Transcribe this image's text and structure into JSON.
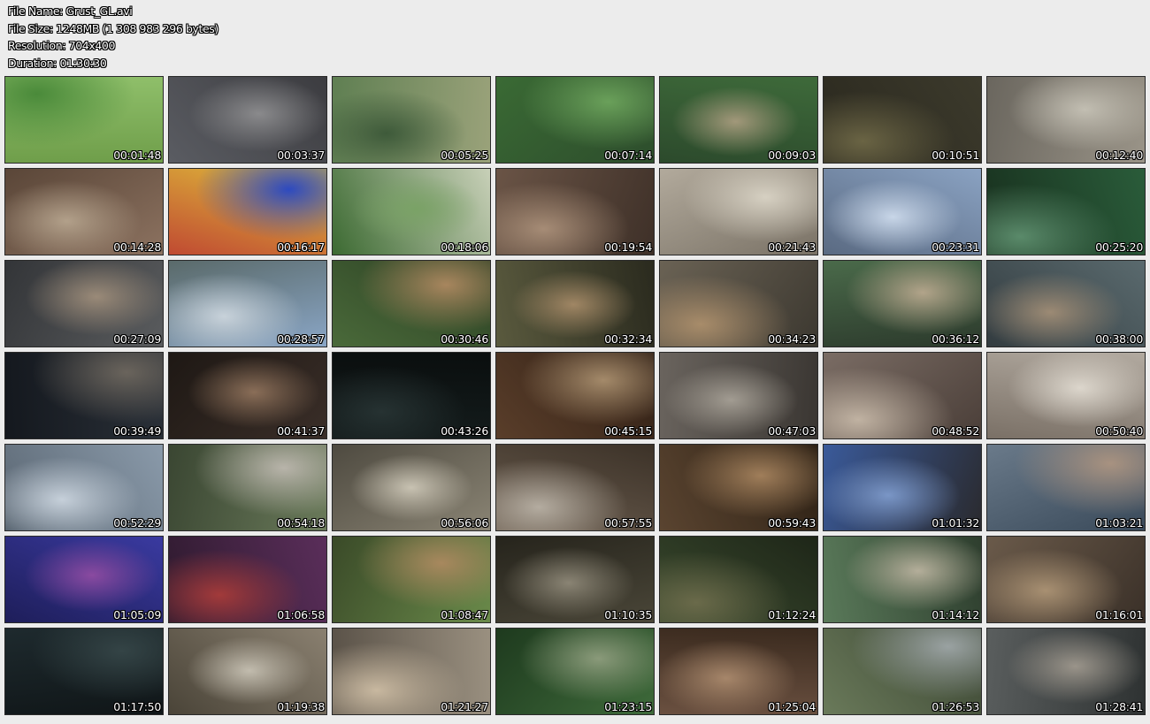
{
  "info": {
    "file_name": "File Name: Grust_GL.avi",
    "file_size": "File Size: 1248MB (1 308 983 296 bytes)",
    "resolution": "Resolution: 704x400",
    "duration": "Duration: 01:30:30"
  },
  "thumbnails": [
    {
      "time": "00:01:48",
      "colors": [
        "#6f9e4a",
        "#4a8a3a",
        "#8fbf6a"
      ]
    },
    {
      "time": "00:03:37",
      "colors": [
        "#5a5c62",
        "#8a8a8c",
        "#3c3c40"
      ]
    },
    {
      "time": "00:05:25",
      "colors": [
        "#5f7f52",
        "#3e5a3a",
        "#9aa27a"
      ]
    },
    {
      "time": "00:07:14",
      "colors": [
        "#3a6a34",
        "#6aa05a",
        "#2d4d2c"
      ]
    },
    {
      "time": "00:09:03",
      "colors": [
        "#3e6a3a",
        "#a2987a",
        "#2c4a2c"
      ]
    },
    {
      "time": "00:10:51",
      "colors": [
        "#3c3a2c",
        "#6a6444",
        "#2a281e"
      ]
    },
    {
      "time": "00:12:40",
      "colors": [
        "#9a9488",
        "#c2beb2",
        "#6a665e"
      ]
    },
    {
      "time": "00:14:28",
      "colors": [
        "#8c7260",
        "#b2a08a",
        "#5a4638"
      ]
    },
    {
      "time": "00:16:17",
      "colors": [
        "#c04a32",
        "#2d4ac0",
        "#e0c03a"
      ]
    },
    {
      "time": "00:18:06",
      "colors": [
        "#3c6a32",
        "#7aa266",
        "#c8d0b8"
      ]
    },
    {
      "time": "00:19:54",
      "colors": [
        "#6a5446",
        "#a68c76",
        "#3e3028"
      ]
    },
    {
      "time": "00:21:43",
      "colors": [
        "#b2aa9c",
        "#d6d0c2",
        "#7a7266"
      ]
    },
    {
      "time": "00:23:31",
      "colors": [
        "#8aa2c2",
        "#c8d6e8",
        "#5a6a82"
      ]
    },
    {
      "time": "00:25:20",
      "colors": [
        "#2a5c3a",
        "#5a8a6a",
        "#18301e"
      ]
    },
    {
      "time": "00:27:09",
      "colors": [
        "#5a5c5e",
        "#9a8a78",
        "#333538"
      ]
    },
    {
      "time": "00:28:57",
      "colors": [
        "#8aa6c6",
        "#c8d2da",
        "#5a6a6a"
      ]
    },
    {
      "time": "00:30:46",
      "colors": [
        "#4a6a3a",
        "#a8865e",
        "#2a3e22"
      ]
    },
    {
      "time": "00:32:34",
      "colors": [
        "#5a5a3e",
        "#a08664",
        "#2a2a1e"
      ]
    },
    {
      "time": "00:34:23",
      "colors": [
        "#6a6254",
        "#a88c6a",
        "#3c3830"
      ]
    },
    {
      "time": "00:36:12",
      "colors": [
        "#4a6a4a",
        "#b2a48a",
        "#2c3a2c"
      ]
    },
    {
      "time": "00:38:00",
      "colors": [
        "#5a6a6e",
        "#9c8a74",
        "#333c40"
      ]
    },
    {
      "time": "00:39:49",
      "colors": [
        "#2a3038",
        "#6a645c",
        "#14181e"
      ]
    },
    {
      "time": "00:41:37",
      "colors": [
        "#3a2e28",
        "#8a6e58",
        "#1e1814"
      ]
    },
    {
      "time": "00:43:26",
      "colors": [
        "#141c1c",
        "#263232",
        "#0a0e0e"
      ]
    },
    {
      "time": "00:45:15",
      "colors": [
        "#5a3e2a",
        "#a48a6a",
        "#2e1e14"
      ]
    },
    {
      "time": "00:47:03",
      "colors": [
        "#6a645e",
        "#a29c92",
        "#3a3632"
      ]
    },
    {
      "time": "00:48:52",
      "colors": [
        "#7a6c64",
        "#c0b2a2",
        "#4a3e38"
      ]
    },
    {
      "time": "00:50:40",
      "colors": [
        "#b2aaa0",
        "#dcd6cc",
        "#7a7066"
      ]
    },
    {
      "time": "00:52:29",
      "colors": [
        "#8a9aaa",
        "#c6d0da",
        "#5a6672"
      ]
    },
    {
      "time": "00:54:18",
      "colors": [
        "#6a7a5a",
        "#b8b4aa",
        "#3a4632"
      ]
    },
    {
      "time": "00:56:06",
      "colors": [
        "#8a8474",
        "#c8c2b2",
        "#4e4a40"
      ]
    },
    {
      "time": "00:57:55",
      "colors": [
        "#6a5c4e",
        "#b4aca0",
        "#3c3228"
      ]
    },
    {
      "time": "00:59:43",
      "colors": [
        "#5a4430",
        "#a07e5a",
        "#2c2014"
      ]
    },
    {
      "time": "01:01:32",
      "colors": [
        "#3a5a9a",
        "#7a96c6",
        "#2a2a2e"
      ]
    },
    {
      "time": "01:03:21",
      "colors": [
        "#6a7a8a",
        "#a89280",
        "#3a4a5a"
      ]
    },
    {
      "time": "01:05:09",
      "colors": [
        "#3a3aa0",
        "#8a4aa0",
        "#1e1e5a"
      ]
    },
    {
      "time": "01:06:58",
      "colors": [
        "#5a2e5a",
        "#a23a3a",
        "#2e1a2e"
      ]
    },
    {
      "time": "01:08:47",
      "colors": [
        "#6a8a4a",
        "#a8885e",
        "#3a4a28"
      ]
    },
    {
      "time": "01:10:35",
      "colors": [
        "#4a4638",
        "#8a8474",
        "#26241c"
      ]
    },
    {
      "time": "01:12:24",
      "colors": [
        "#3a4a2e",
        "#6a6a4a",
        "#1e2618"
      ]
    },
    {
      "time": "01:14:12",
      "colors": [
        "#5a7a5a",
        "#b4ae9a",
        "#2e3e2e"
      ]
    },
    {
      "time": "01:16:01",
      "colors": [
        "#6a5a4a",
        "#a89072",
        "#3a3028"
      ]
    },
    {
      "time": "01:17:50",
      "colors": [
        "#1e2a2e",
        "#344446",
        "#101618"
      ]
    },
    {
      "time": "01:19:38",
      "colors": [
        "#8a8070",
        "#c2bcae",
        "#4a4438"
      ]
    },
    {
      "time": "01:21:27",
      "colors": [
        "#9a9080",
        "#c8b8a0",
        "#5a5248"
      ]
    },
    {
      "time": "01:23:15",
      "colors": [
        "#3e6a3a",
        "#8a9a7a",
        "#1e3a1e"
      ]
    },
    {
      "time": "01:25:04",
      "colors": [
        "#6a5040",
        "#a6866a",
        "#3a2a1e"
      ]
    },
    {
      "time": "01:26:53",
      "colors": [
        "#6a7a5a",
        "#9aa2a2",
        "#3a4432"
      ]
    },
    {
      "time": "01:28:41",
      "colors": [
        "#5a5e5e",
        "#9a948a",
        "#2e3232"
      ]
    }
  ]
}
